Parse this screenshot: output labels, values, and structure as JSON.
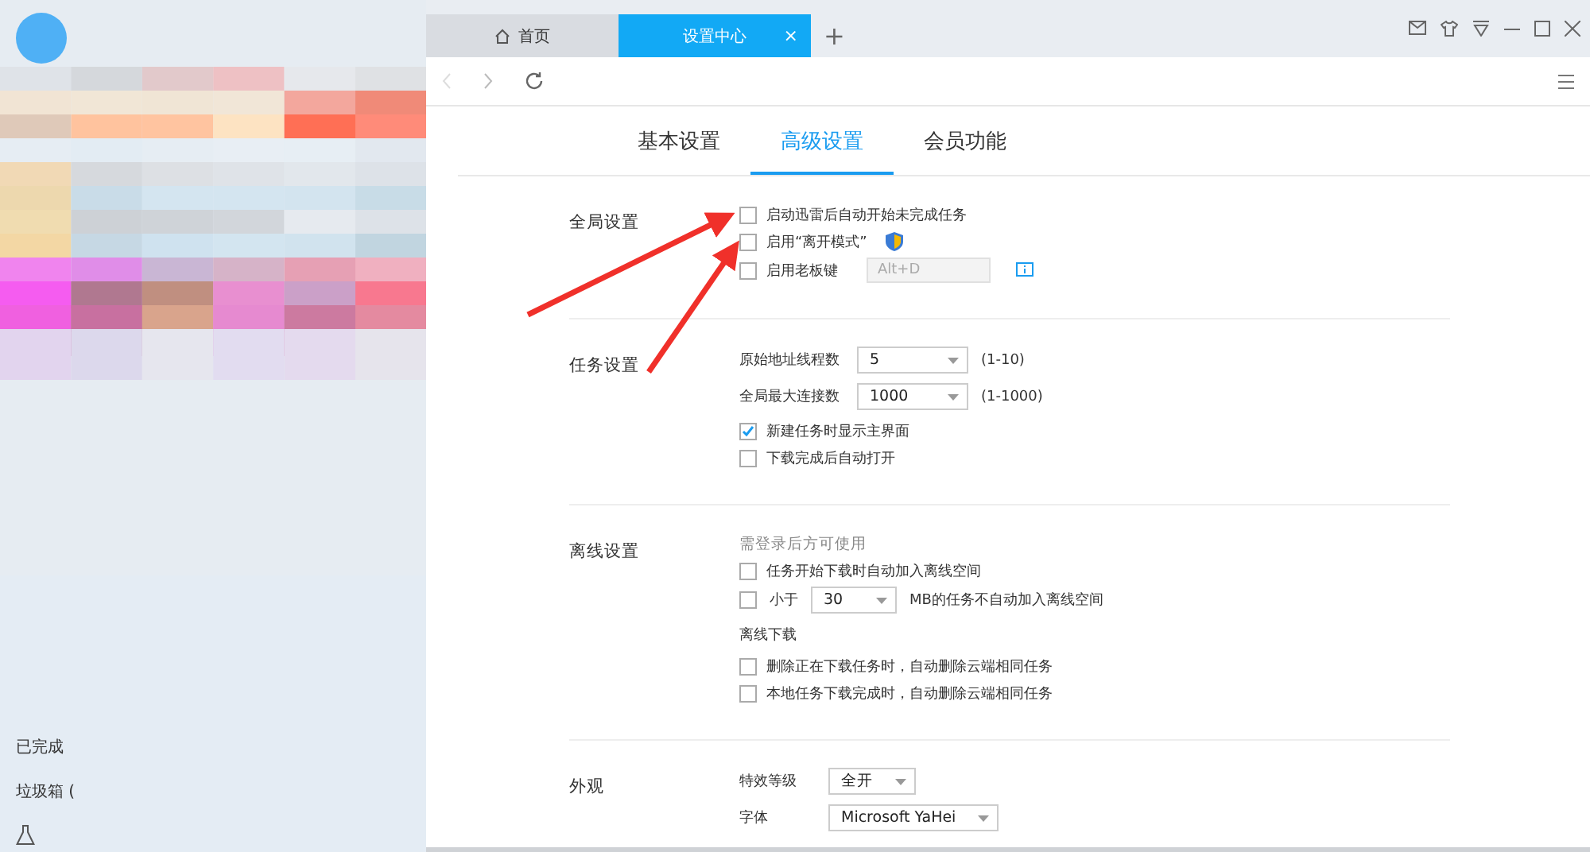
{
  "browser_tabs": [
    {
      "label": "首页",
      "selected": false
    },
    {
      "label": "设置中心",
      "selected": true,
      "close": "×"
    }
  ],
  "new_tab": "+",
  "sidebar": {
    "items": [
      {
        "label": "已完成"
      },
      {
        "label": "垃圾箱 ("
      }
    ]
  },
  "settings_tabs": [
    {
      "label": "基本设置",
      "selected": false
    },
    {
      "label": "高级设置",
      "selected": true
    },
    {
      "label": "会员功能",
      "selected": false
    }
  ],
  "sections": [
    {
      "title": "全局设置",
      "rows": [
        {
          "kind": "checkbox",
          "label": "启动迅雷后自动开始未完成任务",
          "checked": false
        },
        {
          "kind": "checkbox",
          "label": "启用“离开模式”",
          "checked": false,
          "shield": true
        },
        {
          "kind": "checkbox",
          "label": "启用老板键",
          "checked": false,
          "field": "Alt+D",
          "info": true
        }
      ]
    },
    {
      "title": "任务设置",
      "rows": [
        {
          "kind": "select",
          "label": "原始地址线程数",
          "value": "5",
          "hint": "(1-10)"
        },
        {
          "kind": "select",
          "label": "全局最大连接数",
          "value": "1000",
          "hint": "(1-1000)"
        },
        {
          "kind": "checkbox",
          "label": "新建任务时显示主界面",
          "checked": true
        },
        {
          "kind": "checkbox",
          "label": "下载完成后自动打开",
          "checked": false
        }
      ]
    },
    {
      "title": "离线设置",
      "rows": [
        {
          "kind": "note",
          "label": "需登录后方可使用"
        },
        {
          "kind": "checkbox",
          "label": "任务开始下载时自动加入离线空间",
          "checked": false
        },
        {
          "kind": "checkbox-select",
          "label": "小于",
          "checked": false,
          "value": "30",
          "hint": "MB的任务不自动加入离线空间"
        },
        {
          "kind": "subheading",
          "label": "离线下载"
        },
        {
          "kind": "checkbox",
          "label": "删除正在下载任务时，自动删除云端相同任务",
          "checked": false
        },
        {
          "kind": "checkbox",
          "label": "本地任务下载完成时，自动删除云端相同任务",
          "checked": false
        }
      ]
    },
    {
      "title": "外观",
      "rows": [
        {
          "kind": "select",
          "label": "特效等级",
          "value": "全开"
        },
        {
          "kind": "select",
          "label": "字体",
          "value": "Microsoft YaHei"
        }
      ]
    }
  ]
}
